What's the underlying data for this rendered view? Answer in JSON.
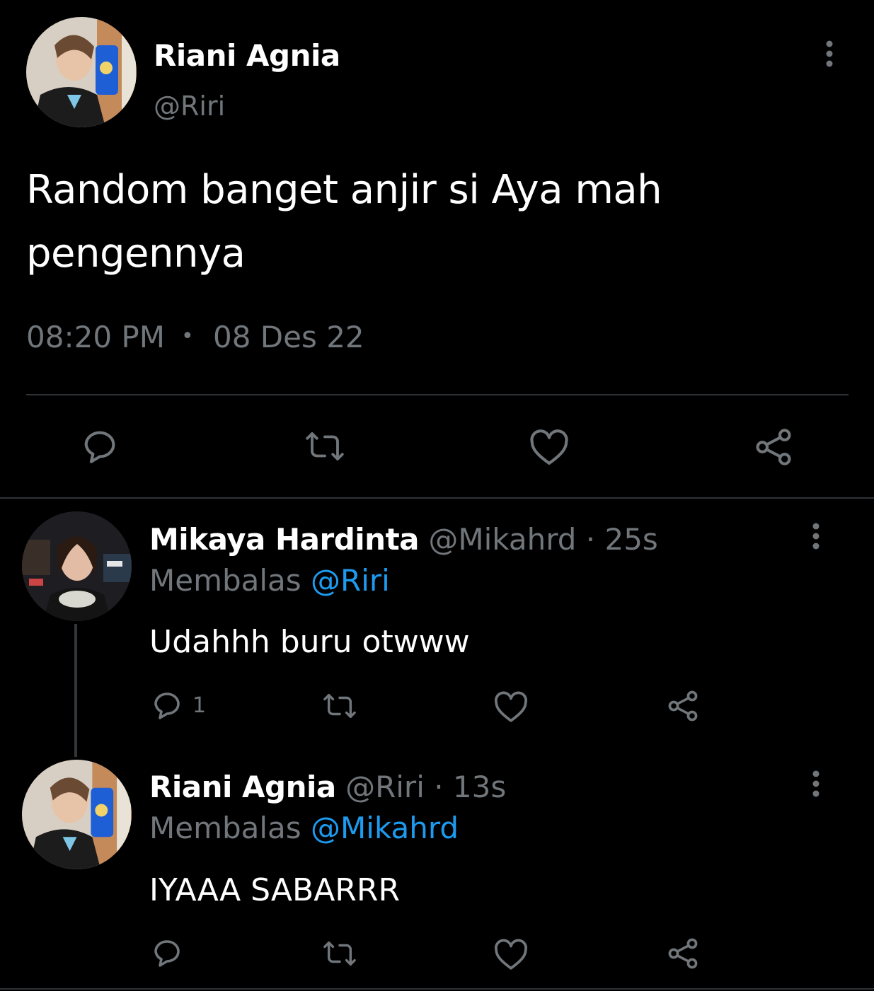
{
  "main_tweet": {
    "author_name": "Riani Agnia",
    "handle": "@Riri",
    "text_line1": "Random banget anjir si Aya mah",
    "text_line2": "pengennya",
    "time": "08:20 PM",
    "separator": "•",
    "date": "08 Des 22"
  },
  "replies": [
    {
      "author_name": "Mikaya Hardinta",
      "handle": "@Mikahrd",
      "age": "· 25s",
      "replying_label": "Membalas",
      "replying_to": "@Riri",
      "text": "Udahhh buru otwww",
      "reply_count": "1"
    },
    {
      "author_name": "Riani Agnia",
      "handle": "@Riri",
      "age": "· 13s",
      "replying_label": "Membalas",
      "replying_to": "@Mikahrd",
      "text": "IYAAA SABARRR",
      "reply_count": ""
    }
  ],
  "icons": {
    "reply": "reply-icon",
    "retweet": "retweet-icon",
    "like": "like-icon",
    "share": "share-icon",
    "more": "more-icon"
  },
  "colors": {
    "background": "#000000",
    "text": "#ffffff",
    "muted": "#71767b",
    "link": "#1d9bf0",
    "divider": "#2f3336"
  }
}
